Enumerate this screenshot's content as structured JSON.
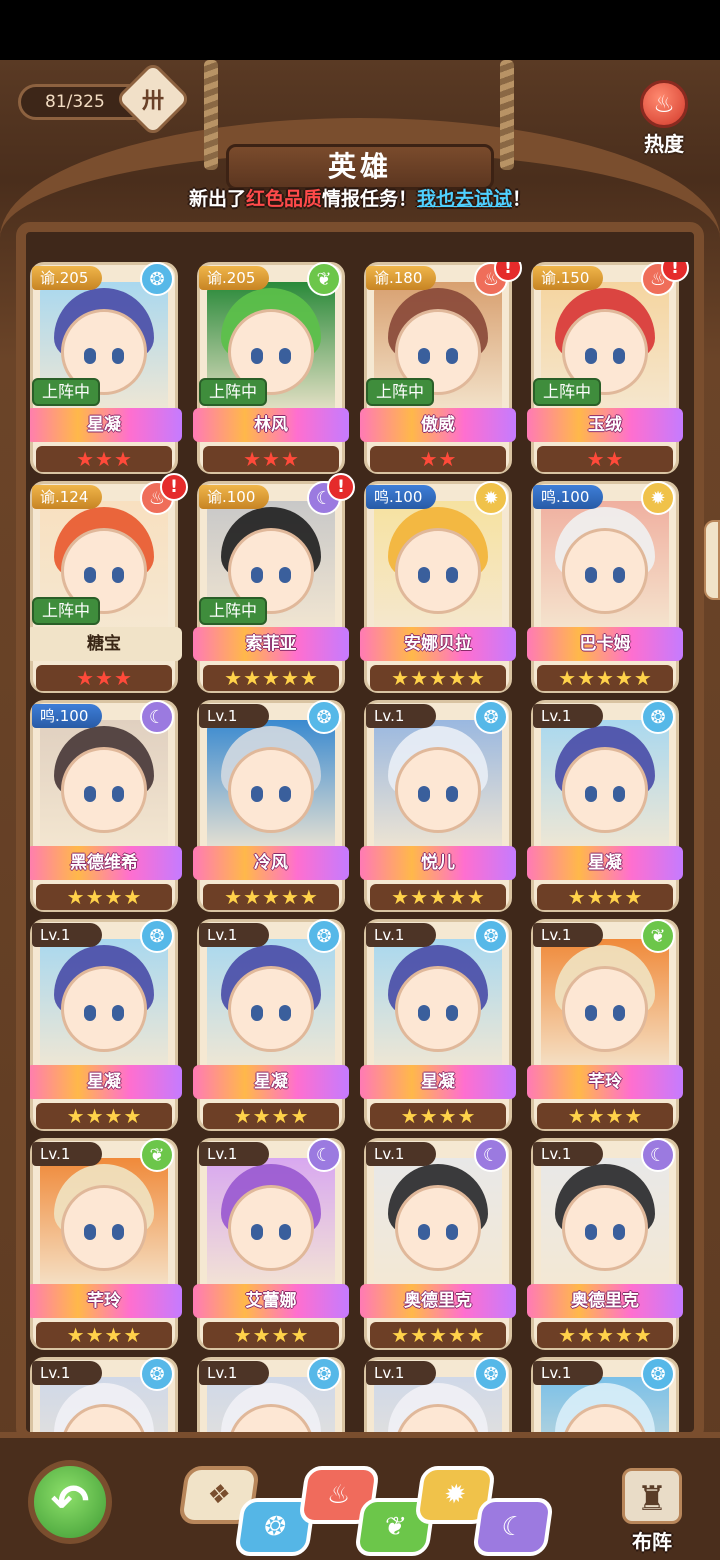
{
  "header": {
    "counter": "81/325",
    "title": "英雄",
    "heat_label": "热度",
    "notice_prefix": "新出了",
    "notice_red": "红色品质",
    "notice_mid": "情报任务！",
    "notice_link": "我也去试试",
    "notice_suffix": "！"
  },
  "heroes": [
    {
      "level": "谕.205",
      "name": "星凝",
      "element": "water",
      "deployed": "上阵中",
      "stars": 3,
      "star_color": "red",
      "alert": false,
      "palette": [
        "#4b4ea8",
        "#a9d8ef"
      ]
    },
    {
      "level": "谕.205",
      "name": "林风",
      "element": "wood",
      "deployed": "上阵中",
      "stars": 3,
      "star_color": "red",
      "alert": false,
      "palette": [
        "#5cc04a",
        "#2a8a3a"
      ]
    },
    {
      "level": "谕.180",
      "name": "傲威",
      "element": "fire",
      "deployed": "上阵中",
      "stars": 2,
      "star_color": "red",
      "alert": true,
      "palette": [
        "#8a4a3a",
        "#d8a070"
      ]
    },
    {
      "level": "谕.150",
      "name": "玉绒",
      "element": "fire",
      "deployed": "上阵中",
      "stars": 2,
      "star_color": "red",
      "alert": true,
      "palette": [
        "#d83838",
        "#f5d5a0"
      ]
    },
    {
      "level": "谕.124",
      "name": "糖宝",
      "element": "fire",
      "deployed": "上阵中",
      "stars": 3,
      "star_color": "red",
      "alert": true,
      "plain": true,
      "palette": [
        "#e85a30",
        "#f8e0c0"
      ]
    },
    {
      "level": "谕.100",
      "name": "索菲亚",
      "element": "dark",
      "deployed": "上阵中",
      "stars": 5,
      "star_color": "gold",
      "alert": true,
      "palette": [
        "#222222",
        "#c8c8c8"
      ]
    },
    {
      "level": "鸣.100",
      "name": "安娜贝拉",
      "element": "light",
      "deployed": "",
      "stars": 5,
      "star_color": "gold",
      "alert": false,
      "palette": [
        "#f2b43a",
        "#f6e2a0"
      ]
    },
    {
      "level": "鸣.100",
      "name": "巴卡姆",
      "element": "light",
      "deployed": "",
      "stars": 5,
      "star_color": "gold",
      "alert": false,
      "palette": [
        "#f0f0f0",
        "#f0b0a0"
      ]
    },
    {
      "level": "鸣.100",
      "name": "黑德维希",
      "element": "dark",
      "deployed": "",
      "stars": 4,
      "star_color": "gold",
      "alert": false,
      "palette": [
        "#4a3a3a",
        "#e0d0c0"
      ]
    },
    {
      "level": "Lv.1",
      "name": "冷风",
      "element": "water",
      "deployed": "",
      "stars": 5,
      "star_color": "gold",
      "alert": false,
      "palette": [
        "#d0d8e0",
        "#3a8ad0"
      ]
    },
    {
      "level": "Lv.1",
      "name": "悦儿",
      "element": "water",
      "deployed": "",
      "stars": 5,
      "star_color": "gold",
      "alert": false,
      "palette": [
        "#e8eef5",
        "#9ab8e0"
      ]
    },
    {
      "level": "Lv.1",
      "name": "星凝",
      "element": "water",
      "deployed": "",
      "stars": 4,
      "star_color": "gold",
      "alert": false,
      "palette": [
        "#4b4ea8",
        "#a9d8ef"
      ]
    },
    {
      "level": "Lv.1",
      "name": "星凝",
      "element": "water",
      "deployed": "",
      "stars": 4,
      "star_color": "gold",
      "alert": false,
      "palette": [
        "#4b4ea8",
        "#a9d8ef"
      ]
    },
    {
      "level": "Lv.1",
      "name": "星凝",
      "element": "water",
      "deployed": "",
      "stars": 4,
      "star_color": "gold",
      "alert": false,
      "palette": [
        "#4b4ea8",
        "#a9d8ef"
      ]
    },
    {
      "level": "Lv.1",
      "name": "星凝",
      "element": "water",
      "deployed": "",
      "stars": 4,
      "star_color": "gold",
      "alert": false,
      "palette": [
        "#4b4ea8",
        "#a9d8ef"
      ]
    },
    {
      "level": "Lv.1",
      "name": "芊玲",
      "element": "wood",
      "deployed": "",
      "stars": 4,
      "star_color": "gold",
      "alert": false,
      "palette": [
        "#f0e2c0",
        "#f08a3a"
      ]
    },
    {
      "level": "Lv.1",
      "name": "芊玲",
      "element": "wood",
      "deployed": "",
      "stars": 4,
      "star_color": "gold",
      "alert": false,
      "palette": [
        "#f0e2c0",
        "#f08a3a"
      ]
    },
    {
      "level": "Lv.1",
      "name": "艾蕾娜",
      "element": "dark",
      "deployed": "",
      "stars": 4,
      "star_color": "gold",
      "alert": false,
      "palette": [
        "#9a5ad0",
        "#d8a8f0"
      ]
    },
    {
      "level": "Lv.1",
      "name": "奥德里克",
      "element": "dark",
      "deployed": "",
      "stars": 5,
      "star_color": "gold",
      "alert": false,
      "palette": [
        "#2a2a2e",
        "#e8e8e8"
      ]
    },
    {
      "level": "Lv.1",
      "name": "奥德里克",
      "element": "dark",
      "deployed": "",
      "stars": 5,
      "star_color": "gold",
      "alert": false,
      "palette": [
        "#2a2a2e",
        "#e8e8e8"
      ]
    },
    {
      "level": "Lv.1",
      "name": "",
      "element": "water",
      "deployed": "",
      "stars": 0,
      "star_color": "gold",
      "alert": false,
      "palette": [
        "#f0f0f5",
        "#cfd8e8"
      ]
    },
    {
      "level": "Lv.1",
      "name": "",
      "element": "water",
      "deployed": "",
      "stars": 0,
      "star_color": "gold",
      "alert": false,
      "palette": [
        "#f0f0f5",
        "#cfd8e8"
      ]
    },
    {
      "level": "Lv.1",
      "name": "",
      "element": "water",
      "deployed": "",
      "stars": 0,
      "star_color": "gold",
      "alert": false,
      "palette": [
        "#f0f0f5",
        "#cfd8e8"
      ]
    },
    {
      "level": "Lv.1",
      "name": "",
      "element": "water",
      "deployed": "",
      "stars": 0,
      "star_color": "gold",
      "alert": false,
      "palette": [
        "#d8eef8",
        "#7ac0e8"
      ]
    }
  ],
  "element_icons": {
    "water": "❂",
    "wood": "❦",
    "fire": "♨",
    "light": "✹",
    "dark": "☾"
  },
  "filters": [
    {
      "id": "all",
      "icon": "❖"
    },
    {
      "id": "water",
      "icon": "❂"
    },
    {
      "id": "fire",
      "icon": "♨"
    },
    {
      "id": "wood",
      "icon": "❦"
    },
    {
      "id": "light",
      "icon": "✹"
    },
    {
      "id": "dark",
      "icon": "☾"
    }
  ],
  "bottom": {
    "back_icon": "↶",
    "formation_icon": "♜",
    "formation_label": "布阵"
  }
}
